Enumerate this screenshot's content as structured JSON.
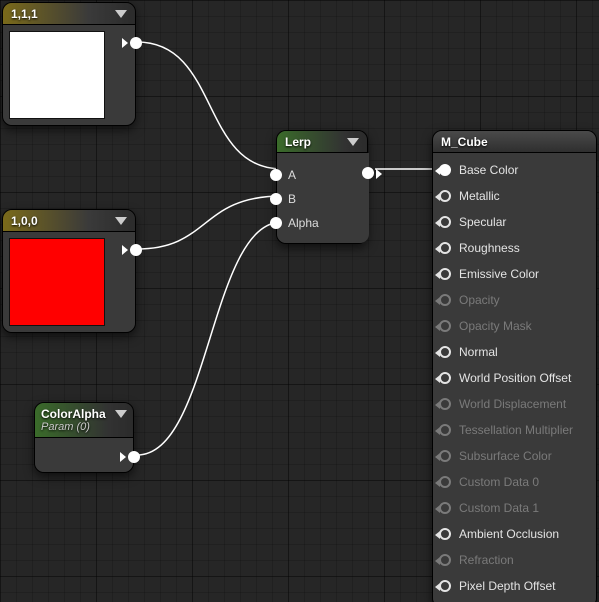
{
  "nodes": {
    "const_white": {
      "title": "1,1,1",
      "swatch_color": "#ffffff"
    },
    "const_red": {
      "title": "1,0,0",
      "swatch_color": "#ff0000"
    },
    "param_alpha": {
      "title": "ColorAlpha",
      "subtitle": "Param (0)"
    },
    "lerp": {
      "title": "Lerp",
      "inputs": [
        "A",
        "B",
        "Alpha"
      ]
    },
    "output": {
      "title": "M_Cube",
      "pins": [
        {
          "label": "Base Color",
          "enabled": true,
          "connected": true
        },
        {
          "label": "Metallic",
          "enabled": true,
          "connected": false
        },
        {
          "label": "Specular",
          "enabled": true,
          "connected": false
        },
        {
          "label": "Roughness",
          "enabled": true,
          "connected": false
        },
        {
          "label": "Emissive Color",
          "enabled": true,
          "connected": false
        },
        {
          "label": "Opacity",
          "enabled": false,
          "connected": false
        },
        {
          "label": "Opacity Mask",
          "enabled": false,
          "connected": false
        },
        {
          "label": "Normal",
          "enabled": true,
          "connected": false
        },
        {
          "label": "World Position Offset",
          "enabled": true,
          "connected": false
        },
        {
          "label": "World Displacement",
          "enabled": false,
          "connected": false
        },
        {
          "label": "Tessellation Multiplier",
          "enabled": false,
          "connected": false
        },
        {
          "label": "Subsurface Color",
          "enabled": false,
          "connected": false
        },
        {
          "label": "Custom Data 0",
          "enabled": false,
          "connected": false
        },
        {
          "label": "Custom Data 1",
          "enabled": false,
          "connected": false
        },
        {
          "label": "Ambient Occlusion",
          "enabled": true,
          "connected": false
        },
        {
          "label": "Refraction",
          "enabled": false,
          "connected": false
        },
        {
          "label": "Pixel Depth Offset",
          "enabled": true,
          "connected": false
        }
      ]
    }
  }
}
